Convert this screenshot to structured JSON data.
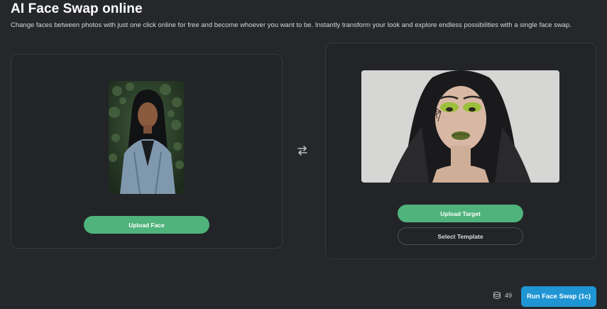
{
  "header": {
    "title": "AI Face Swap online",
    "subtitle": "Change faces between photos with just one click online for free and become whoever you want to be. Instantly transform your look and explore endless possibilities with a single face swap."
  },
  "face_panel": {
    "upload_label": "Upload Face"
  },
  "target_panel": {
    "upload_label": "Upload Target",
    "template_label": "Select Template"
  },
  "footer": {
    "credits": "49",
    "run_label": "Run Face Swap (1c)"
  },
  "colors": {
    "background": "#25272b",
    "panel": "#222428",
    "primary_green": "#4fb37b",
    "run_blue": "#1f95d4"
  },
  "icons": {
    "swap": "swap-arrows-icon",
    "credits": "coin-stack-icon"
  }
}
